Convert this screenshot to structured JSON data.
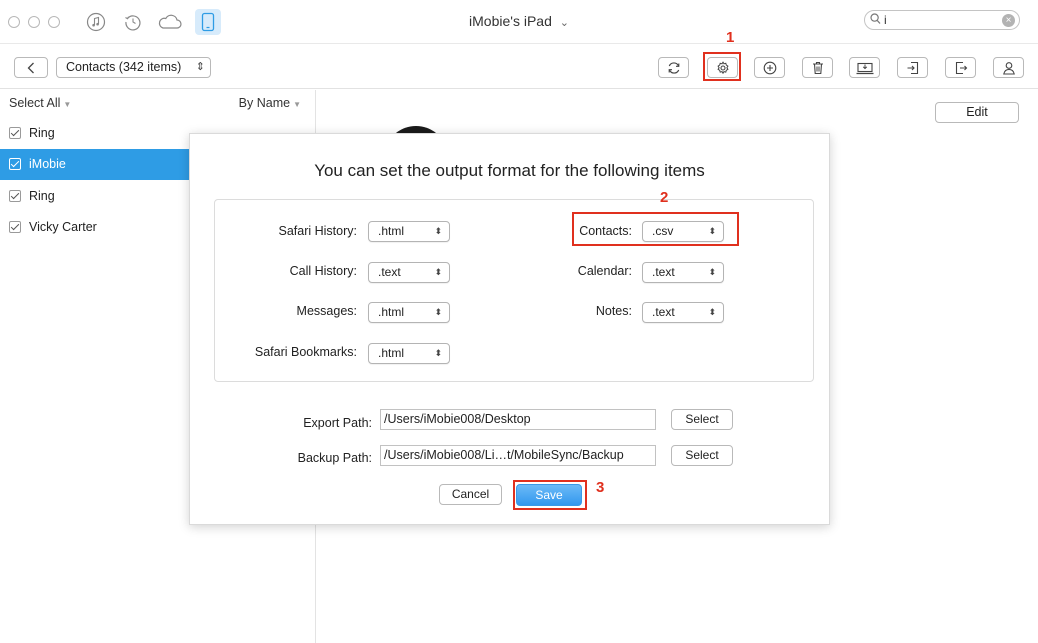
{
  "window": {
    "title": "iMobie's iPad",
    "title_caret": "⌄"
  },
  "search": {
    "value": "i",
    "clear_glyph": "×"
  },
  "nav_icons": [
    "music-icon",
    "history-icon",
    "cloud-icon",
    "device-icon"
  ],
  "toolbar": {
    "category": "Contacts (342 items)",
    "category_arrows": "◇",
    "buttons": [
      "refresh-icon",
      "settings-icon",
      "add-icon",
      "delete-icon",
      "export-to-computer-icon",
      "import-icon",
      "export-icon",
      "contact-icon"
    ]
  },
  "sidebar": {
    "select_all": "Select All",
    "sort": "By Name",
    "contacts": [
      {
        "name": "Ring",
        "checked": true,
        "selected": false
      },
      {
        "name": "iMobie",
        "checked": true,
        "selected": true
      },
      {
        "name": "Ring",
        "checked": true,
        "selected": false
      },
      {
        "name": "Vicky Carter",
        "checked": true,
        "selected": false
      }
    ]
  },
  "content": {
    "edit_label": "Edit"
  },
  "dialog": {
    "title": "You can set the output format for the following items",
    "formats": {
      "safari_history": {
        "label": "Safari History:",
        "value": ".html"
      },
      "call_history": {
        "label": "Call History:",
        "value": ".text"
      },
      "messages": {
        "label": "Messages:",
        "value": ".html"
      },
      "safari_bookmarks": {
        "label": "Safari Bookmarks:",
        "value": ".html"
      },
      "contacts": {
        "label": "Contacts:",
        "value": ".csv"
      },
      "calendar": {
        "label": "Calendar:",
        "value": ".text"
      },
      "notes": {
        "label": "Notes:",
        "value": ".text"
      }
    },
    "export_path": {
      "label": "Export Path:",
      "value": "/Users/iMobie008/Desktop",
      "button": "Select"
    },
    "backup_path": {
      "label": "Backup Path:",
      "value": "/Users/iMobie008/Li…t/MobileSync/Backup",
      "button": "Select"
    },
    "cancel_label": "Cancel",
    "save_label": "Save"
  },
  "annotations": {
    "step1": "1",
    "step2": "2",
    "step3": "3",
    "color": "#e0301e"
  },
  "colors": {
    "accent": "#2e9ce5",
    "save_button": "#3b99e6"
  }
}
